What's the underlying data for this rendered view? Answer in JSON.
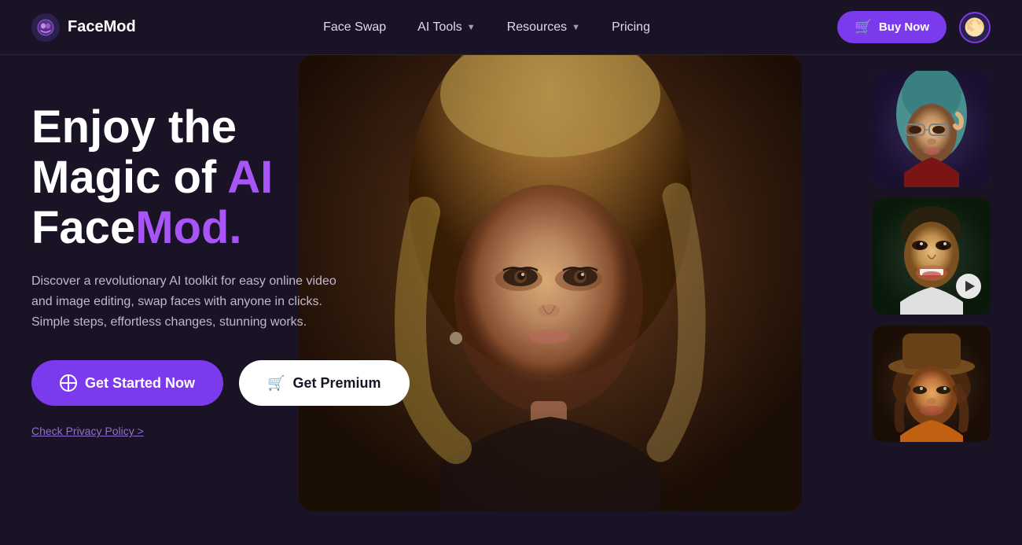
{
  "brand": {
    "name": "FaceMod",
    "logo_symbol": "😶"
  },
  "navbar": {
    "face_swap_label": "Face Swap",
    "ai_tools_label": "AI Tools",
    "resources_label": "Resources",
    "pricing_label": "Pricing",
    "buy_now_label": "Buy Now",
    "avatar_symbol": "🌕"
  },
  "hero": {
    "title_line1": "Enjoy the",
    "title_line2_prefix": "Magic of ",
    "title_line2_ai": "AI",
    "title_line3_prefix": "Face",
    "title_line3_suffix": "Mod.",
    "subtitle": "Discover a revolutionary AI toolkit for easy online video and image editing, swap faces with anyone in clicks. Simple steps, effortless changes, stunning works.",
    "get_started_label": "Get Started Now",
    "get_premium_label": "Get Premium",
    "privacy_link_label": "Check Privacy Policy >"
  },
  "colors": {
    "accent": "#7c3aed",
    "accent_text": "#a855f7",
    "bg": "#1a1225",
    "nav_text": "#e0d8f0"
  }
}
